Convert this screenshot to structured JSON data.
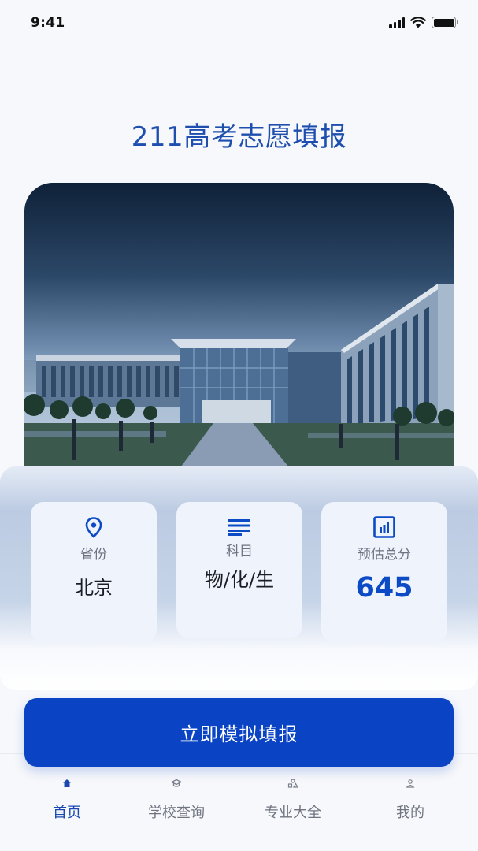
{
  "status_bar": {
    "time": "9:41"
  },
  "header": {
    "title": "211高考志愿填报"
  },
  "hero": {
    "icon": "campus-building-photo"
  },
  "stats": [
    {
      "icon": "location-pin-icon",
      "label": "省份",
      "value": "北京"
    },
    {
      "icon": "list-lines-icon",
      "label": "科目",
      "value": "物/化/生"
    },
    {
      "icon": "bar-chart-icon",
      "label": "预估总分",
      "value": "645"
    }
  ],
  "cta": {
    "label": "立即模拟填报"
  },
  "tabs": [
    {
      "icon": "home-icon",
      "label": "首页",
      "active": true
    },
    {
      "icon": "graduation-cap-icon",
      "label": "学校查询",
      "active": false
    },
    {
      "icon": "shapes-icon",
      "label": "专业大全",
      "active": false
    },
    {
      "icon": "user-icon",
      "label": "我的",
      "active": false
    }
  ],
  "colors": {
    "primary": "#0a43c4",
    "title": "#1f4fae",
    "background": "#f6f8fc"
  }
}
